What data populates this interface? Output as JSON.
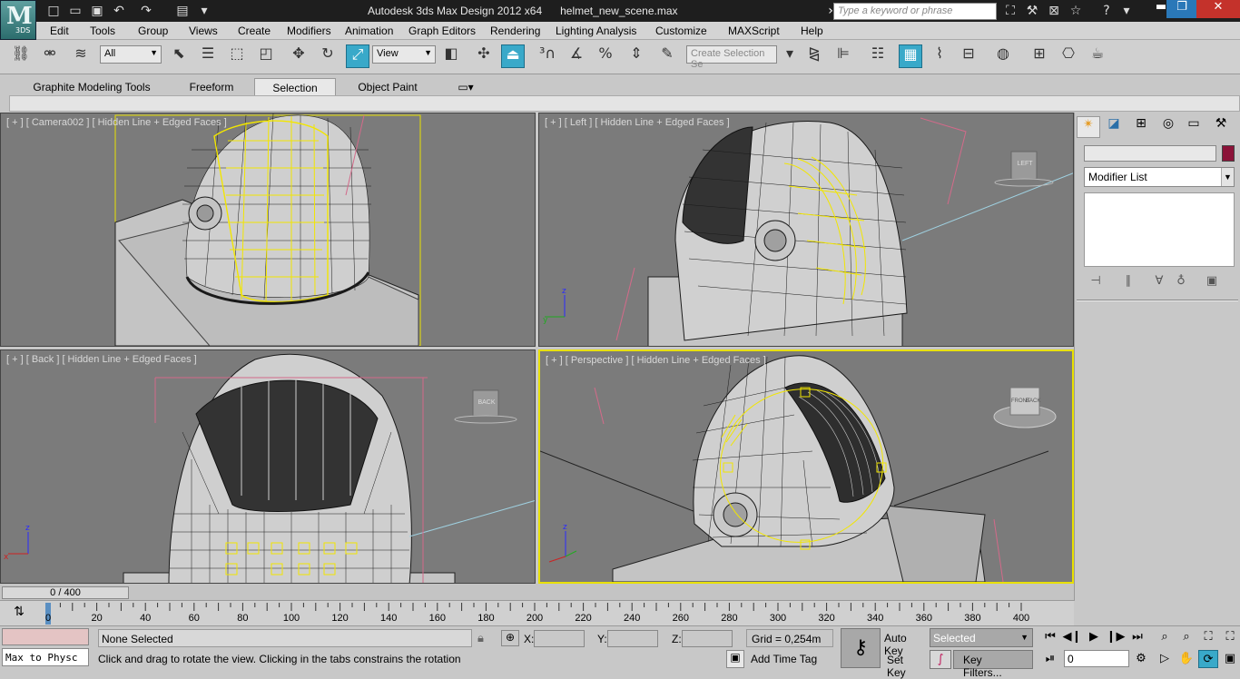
{
  "titlebar": {
    "title": "Autodesk 3ds Max Design 2012 x64      helmet_new_scene.max",
    "search_placeholder": "Type a keyword or phrase",
    "logo_text": "M",
    "logo_sub": "3DS"
  },
  "menu": [
    "Edit",
    "Tools",
    "Group",
    "Views",
    "Create",
    "Modifiers",
    "Animation",
    "Graph Editors",
    "Rendering",
    "Lighting Analysis",
    "Customize",
    "MAXScript",
    "Help"
  ],
  "toolbar": {
    "filter_value": "All",
    "refcoord_value": "View",
    "selection_set_placeholder": "Create Selection Se"
  },
  "ribbon": {
    "tabs": [
      "Graphite Modeling Tools",
      "Freeform",
      "Selection",
      "Object Paint"
    ],
    "selected_tab": "Selection"
  },
  "viewports": [
    {
      "label": "[ + ] [ Camera002 ] [ Hidden Line + Edged Faces ]"
    },
    {
      "label": "[ + ] [ Left ] [ Hidden Line + Edged Faces ]",
      "cube": "LEFT"
    },
    {
      "label": "[ + ] [ Back ] [ Hidden Line + Edged Faces ]",
      "cube": "BACK"
    },
    {
      "label": "[ + ] [ Perspective ] [ Hidden Line + Edged Faces ]",
      "cube_front": "FRONT",
      "cube_back": "BACK"
    }
  ],
  "command_panel": {
    "modifier_list": "Modifier List"
  },
  "timeline": {
    "slider_label": "0 / 400",
    "ticks": [
      "0",
      "20",
      "40",
      "60",
      "80",
      "100",
      "120",
      "140",
      "160",
      "180",
      "200",
      "220",
      "240",
      "260",
      "280",
      "300",
      "320",
      "340",
      "360",
      "380",
      "400"
    ]
  },
  "status": {
    "maxscript": "Max to Physc",
    "selection_status": "None Selected",
    "prompt": "Click and drag to rotate the view.  Clicking in the tabs constrains the rotation",
    "x_label": "X:",
    "y_label": "Y:",
    "z_label": "Z:",
    "grid": "Grid = 0,254m",
    "add_time_tag": "Add Time Tag",
    "auto_key": "Auto Key",
    "set_key": "Set Key",
    "selected_dd": "Selected",
    "key_filters": "Key Filters...",
    "frame": "0"
  },
  "colors": {
    "active_viewport": "#e8e000",
    "selection_yellow": "#f2e600",
    "mesh_line": "#1a1a1a",
    "viewport_bg": "#7b7b7b",
    "active_tool": "#39a9c9"
  }
}
